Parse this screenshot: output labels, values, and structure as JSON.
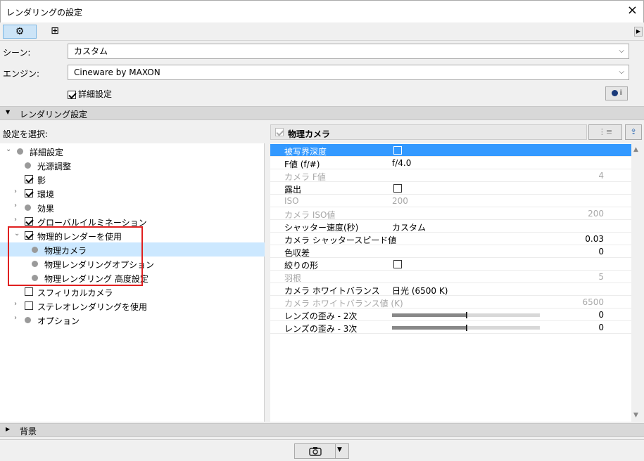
{
  "window": {
    "title": "レンダリングの設定",
    "close": "×"
  },
  "toolbar": {
    "tabs": [
      "⚙",
      "⊞"
    ],
    "right_arrow": "▶"
  },
  "scene": {
    "label": "シーン:",
    "value": "カスタム"
  },
  "engine": {
    "label": "エンジン:",
    "value": "Cineware by MAXON"
  },
  "detail": {
    "label": "詳細設定",
    "checked": true
  },
  "cinema_button": "i",
  "section_render": {
    "label": "レンダリング設定"
  },
  "select_label": "設定を選択:",
  "tree": [
    {
      "label": "詳細設定",
      "level": 0,
      "expand": "down",
      "mark": "dot"
    },
    {
      "label": "光源調整",
      "level": 1,
      "expand": "",
      "mark": "dot"
    },
    {
      "label": "影",
      "level": 1,
      "expand": "",
      "mark": "check"
    },
    {
      "label": "環境",
      "level": 1,
      "expand": "right",
      "mark": "check"
    },
    {
      "label": "効果",
      "level": 1,
      "expand": "right",
      "mark": "dot"
    },
    {
      "label": "グローバルイルミネーション",
      "level": 1,
      "expand": "right",
      "mark": "check"
    },
    {
      "label": "物理的レンダーを使用",
      "level": 1,
      "expand": "down",
      "mark": "check"
    },
    {
      "label": "物理カメラ",
      "level": 2,
      "expand": "",
      "mark": "dot",
      "selected": true
    },
    {
      "label": "物理レンダリングオプション",
      "level": 2,
      "expand": "",
      "mark": "dot"
    },
    {
      "label": "物理レンダリング 高度設定",
      "level": 2,
      "expand": "",
      "mark": "dot"
    },
    {
      "label": "スフィリカルカメラ",
      "level": 1,
      "expand": "",
      "mark": "uncheck"
    },
    {
      "label": "ステレオレンダリングを使用",
      "level": 1,
      "expand": "right",
      "mark": "uncheck"
    },
    {
      "label": "オプション",
      "level": 1,
      "expand": "right",
      "mark": "dot"
    }
  ],
  "panel": {
    "title": "物理カメラ",
    "btn1": "⋮≡",
    "btn2": "⇪"
  },
  "props": [
    {
      "name": "被写界深度",
      "type": "check",
      "checked": false,
      "selected": true
    },
    {
      "name": "F値 (f/#)",
      "type": "text",
      "value": "f/4.0"
    },
    {
      "name": "カメラ F値",
      "type": "right",
      "value": "4",
      "dim": true
    },
    {
      "name": "露出",
      "type": "check",
      "checked": false
    },
    {
      "name": "ISO",
      "type": "text",
      "value": "200",
      "dim": true
    },
    {
      "name": "カメラ ISO値",
      "type": "right",
      "value": "200",
      "dim": true
    },
    {
      "name": "シャッター速度(秒)",
      "type": "text",
      "value": "カスタム"
    },
    {
      "name": "カメラ シャッタースピード値",
      "type": "right",
      "value": "0.03"
    },
    {
      "name": "色収差",
      "type": "right",
      "value": "0"
    },
    {
      "name": "絞りの形",
      "type": "check",
      "checked": false
    },
    {
      "name": "羽根",
      "type": "right",
      "value": "5",
      "dim": true
    },
    {
      "name": "カメラ ホワイトバランス",
      "type": "text",
      "value": "日光 (6500 K)"
    },
    {
      "name": "カメラ ホワイトバランス値 (K)",
      "type": "right",
      "value": "6500",
      "dim": true
    },
    {
      "name": "レンズの歪み - 2次",
      "type": "slider",
      "value": "0",
      "fraction": 0.5
    },
    {
      "name": "レンズの歪み - 3次",
      "type": "slider",
      "value": "0",
      "fraction": 0.5
    }
  ],
  "section_bg": {
    "label": "背景"
  },
  "render_button": {
    "icon": "📷",
    "caret": "▼"
  },
  "colors": {
    "selection": "#3399ff",
    "tree_selection": "#cce8ff",
    "highlight": "#e02020"
  }
}
